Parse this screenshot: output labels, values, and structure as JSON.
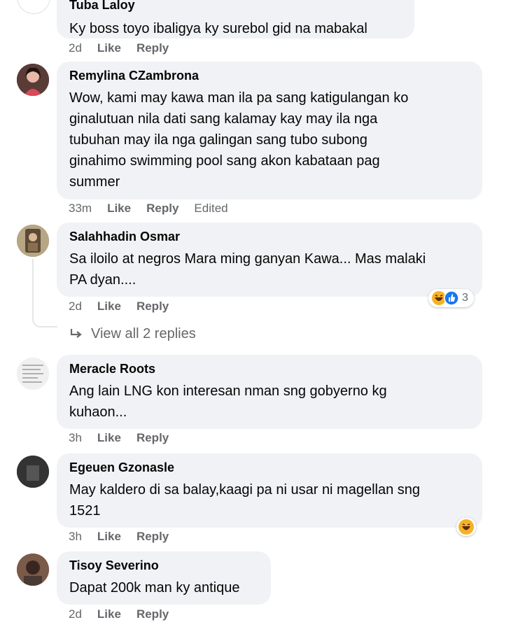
{
  "comments": [
    {
      "author": "Tuba Laloy",
      "text_lines": [
        "Ky boss toyo ibaligya ky surebol gid na mabakal"
      ],
      "time": "2d",
      "like": "Like",
      "reply": "Reply"
    },
    {
      "author": "Remylina CZambrona",
      "text_lines": [
        "Wow, kami may kawa man ila pa sang katigulangan ko",
        "ginalutuan nila dati sang kalamay kay may ila nga",
        "tubuhan may ila nga galingan sang tubo subong",
        "ginahimo swimming pool sang akon kabataan pag",
        "summer"
      ],
      "time": "33m",
      "like": "Like",
      "reply": "Reply",
      "edited": "Edited"
    },
    {
      "author": "Salahhadin Osmar",
      "text_lines": [
        "Sa iloilo at negros Mara ming ganyan Kawa... Mas malaki",
        "PA dyan...."
      ],
      "time": "2d",
      "like": "Like",
      "reply": "Reply",
      "reaction_count": "3",
      "view_replies": "View all 2 replies"
    },
    {
      "author": "Meracle Roots",
      "text_lines": [
        "Ang lain LNG kon interesan nman sng gobyerno kg",
        "kuhaon..."
      ],
      "time": "3h",
      "like": "Like",
      "reply": "Reply"
    },
    {
      "author": "Egeuen Gzonasle",
      "text_lines": [
        "May kaldero di sa balay,kaagi pa ni usar ni magellan sng",
        "1521"
      ],
      "time": "3h",
      "like": "Like",
      "reply": "Reply"
    },
    {
      "author": "Tisoy Severino",
      "text_lines": [
        "Dapat 200k man ky antique"
      ],
      "time": "2d",
      "like": "Like",
      "reply": "Reply"
    }
  ],
  "colors": {
    "bubble": "#f0f2f5",
    "meta": "#65676b",
    "like_blue": "#1877f2",
    "haha_yellow": "#f7b125"
  },
  "icons": {
    "reply_arrow": "reply-arrow-icon",
    "haha": "haha-emoji-icon",
    "like": "like-reaction-icon"
  }
}
